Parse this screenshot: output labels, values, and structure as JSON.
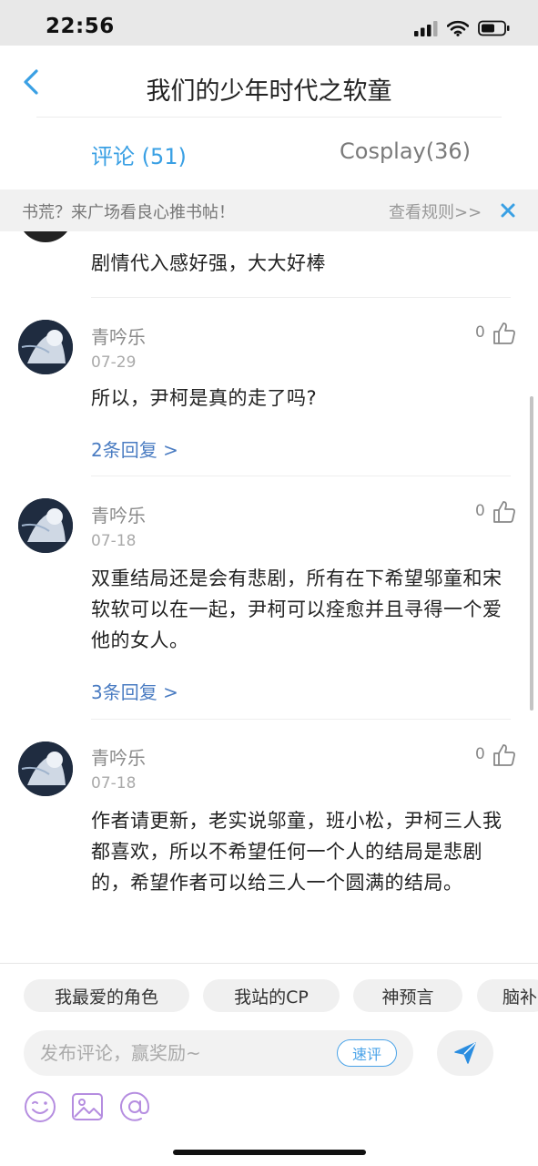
{
  "status_bar": {
    "time": "22:56"
  },
  "header": {
    "title": "我们的少年时代之软童"
  },
  "tabs": [
    {
      "label": "评论 (51)",
      "active": true
    },
    {
      "label": "Cosplay(36)",
      "active": false
    }
  ],
  "notice": {
    "text": "书荒？来广场看良心推书帖！",
    "link": "查看规则>>"
  },
  "comments": [
    {
      "text": "剧情代入感好强，大大好棒"
    },
    {
      "user": "青吟乐",
      "date": "07-29",
      "likes": "0",
      "text": "所以，尹柯是真的走了吗?",
      "replies": "2条回复 >"
    },
    {
      "user": "青吟乐",
      "date": "07-18",
      "likes": "0",
      "text": "双重结局还是会有悲剧，所有在下希望邬童和宋软软可以在一起，尹柯可以痊愈并且寻得一个爱他的女人。",
      "replies": "3条回复 >"
    },
    {
      "user": "青吟乐",
      "date": "07-18",
      "likes": "0",
      "text": "作者请更新，老实说邬童，班小松，尹柯三人我都喜欢，所以不希望任何一个人的结局是悲剧的，希望作者可以给三人一个圆满的结局。"
    }
  ],
  "quick_tags": [
    "我最爱的角色",
    "我站的CP",
    "神预言",
    "脑补"
  ],
  "composer": {
    "placeholder": "发布评论，赢奖励~",
    "quick_label": "速评"
  },
  "colors": {
    "accent": "#3aa0e4",
    "reply_link": "#4a7cc2"
  },
  "icons": [
    "back-chevron-icon",
    "close-icon",
    "thumbs-up-icon",
    "send-icon",
    "emoji-icon",
    "image-icon",
    "at-icon"
  ]
}
